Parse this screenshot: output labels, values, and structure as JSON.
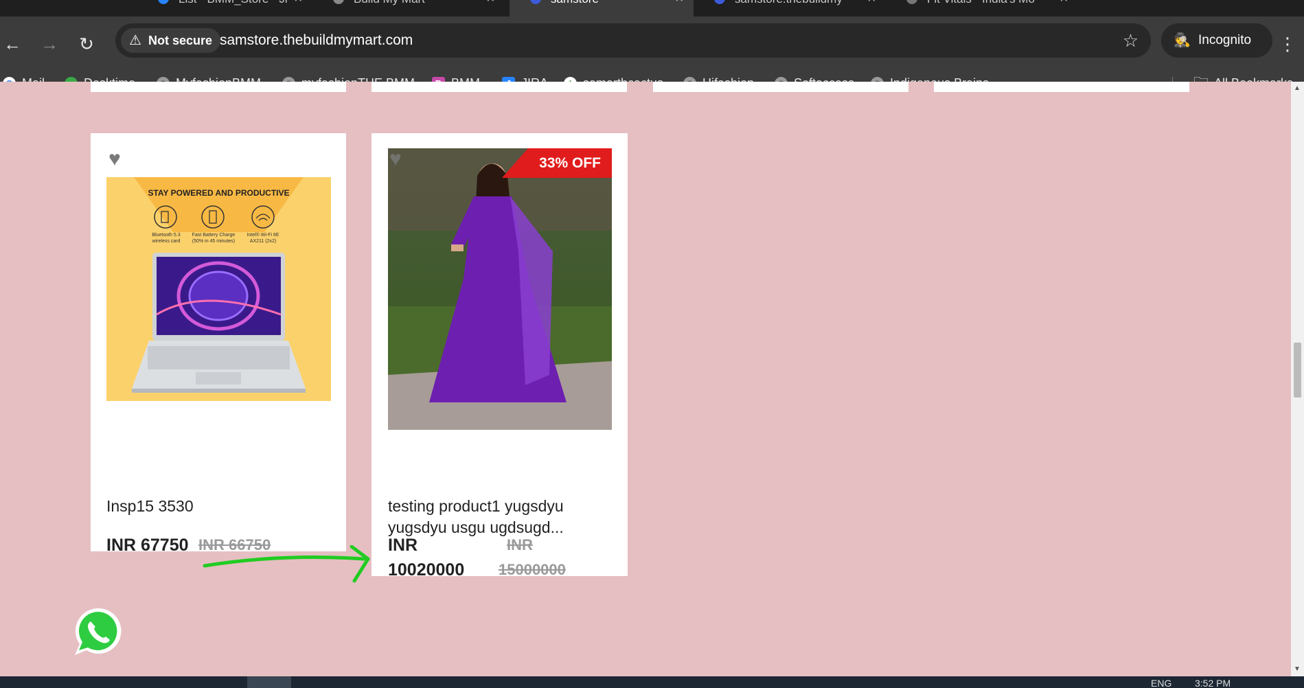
{
  "browser": {
    "tabs": [
      {
        "title": "List - BMM_Store - Ji"
      },
      {
        "title": "Build My Mart"
      },
      {
        "title": "samstore"
      },
      {
        "title": "samstore.thebuildmy"
      },
      {
        "title": "Fit Vitals - India's Mo"
      }
    ],
    "nav": {
      "back": "←",
      "forward": "→",
      "reload": "↻"
    },
    "security_label": "Not secure",
    "url": "samstore.thebuildmymart.com",
    "incognito_label": "Incognito",
    "bookmarks": [
      {
        "label": "Mail",
        "icon": "google-icon"
      },
      {
        "label": "Desktime",
        "icon": "desktime-icon"
      },
      {
        "label": "MyfashionBMM",
        "icon": "globe-icon"
      },
      {
        "label": "myfashionTHE BMM",
        "icon": "globe-icon"
      },
      {
        "label": "BMM",
        "icon": "bmm-icon"
      },
      {
        "label": "JIRA",
        "icon": "jira-icon"
      },
      {
        "label": "samarthcactus",
        "icon": "cactus-icon"
      },
      {
        "label": "Hifashion",
        "icon": "globe-icon"
      },
      {
        "label": "Softaccess",
        "icon": "globe-icon"
      },
      {
        "label": "Indigenous Brains -...",
        "icon": "globe-icon"
      }
    ],
    "all_bookmarks_label": "All Bookmarks"
  },
  "products": [
    {
      "name": "Insp15 3530",
      "price": "INR 67750",
      "old_price": "INR 66750",
      "image_banner": "STAY POWERED AND PRODUCTIVE",
      "features": [
        {
          "line1": "Bluetooth 5.3",
          "line2": "wireless card"
        },
        {
          "line1": "Fast Battery Charge",
          "line2": "(50% in 45 minutes)"
        },
        {
          "line1": "Intel® Wi-Fi 6E",
          "line2": "AX211 (2x2)"
        }
      ]
    },
    {
      "name": "testing product1 yugsdyu yugsdyu usgu ugdsugd...",
      "name_line1": "testing product1 yugsdyu",
      "name_line2": "yugsdyu usgu ugdsugd...",
      "price_line1": "INR",
      "price_line2": "10020000",
      "old_price_line1": "INR",
      "old_price_line2": "15000000",
      "badge": "33% OFF"
    }
  ],
  "taskbar": {
    "lang": "ENG",
    "time": "3:52 PM"
  },
  "colors": {
    "page_bg": "#e6bfc2",
    "badge": "#e01c1c",
    "annotation_arrow": "#22cc22"
  }
}
